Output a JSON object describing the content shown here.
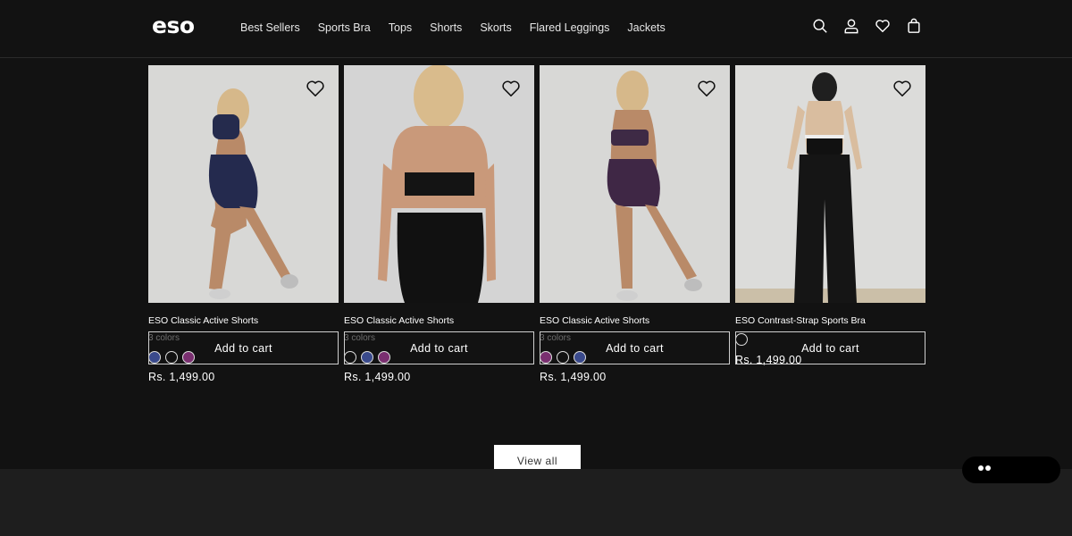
{
  "header": {
    "logo": "eso",
    "nav": [
      "Best Sellers",
      "Sports Bra",
      "Tops",
      "Shorts",
      "Skorts",
      "Flared Leggings",
      "Jackets"
    ],
    "icons": [
      "search-icon",
      "account-icon",
      "wishlist-icon",
      "cart-icon"
    ]
  },
  "products": [
    {
      "title": "ESO Classic Active Shorts",
      "colors_label": "3 colors",
      "swatches": [
        "#3a4a8c",
        "#111111",
        "#7a2f70"
      ],
      "price": "Rs. 1,499.00",
      "button": "Add to cart"
    },
    {
      "title": "ESO Classic Active Shorts",
      "colors_label": "3 colors",
      "swatches": [
        "#111111",
        "#3a4a8c",
        "#7a2f70"
      ],
      "price": "Rs. 1,499.00",
      "button": "Add to cart"
    },
    {
      "title": "ESO Classic Active Shorts",
      "colors_label": "3 colors",
      "swatches": [
        "#7a2f70",
        "#111111",
        "#3a4a8c"
      ],
      "price": "Rs. 1,499.00",
      "button": "Add to cart"
    },
    {
      "title": "ESO Contrast-Strap Sports Bra",
      "colors_label": "",
      "swatches": [
        "#111111"
      ],
      "price": "Rs. 1,499.00",
      "button": "Add to cart"
    }
  ],
  "view_all": "View all",
  "colors": {
    "background": "#121212",
    "footer": "#1e1e1e",
    "text": "#ffffff",
    "muted": "#6e6e6e"
  }
}
